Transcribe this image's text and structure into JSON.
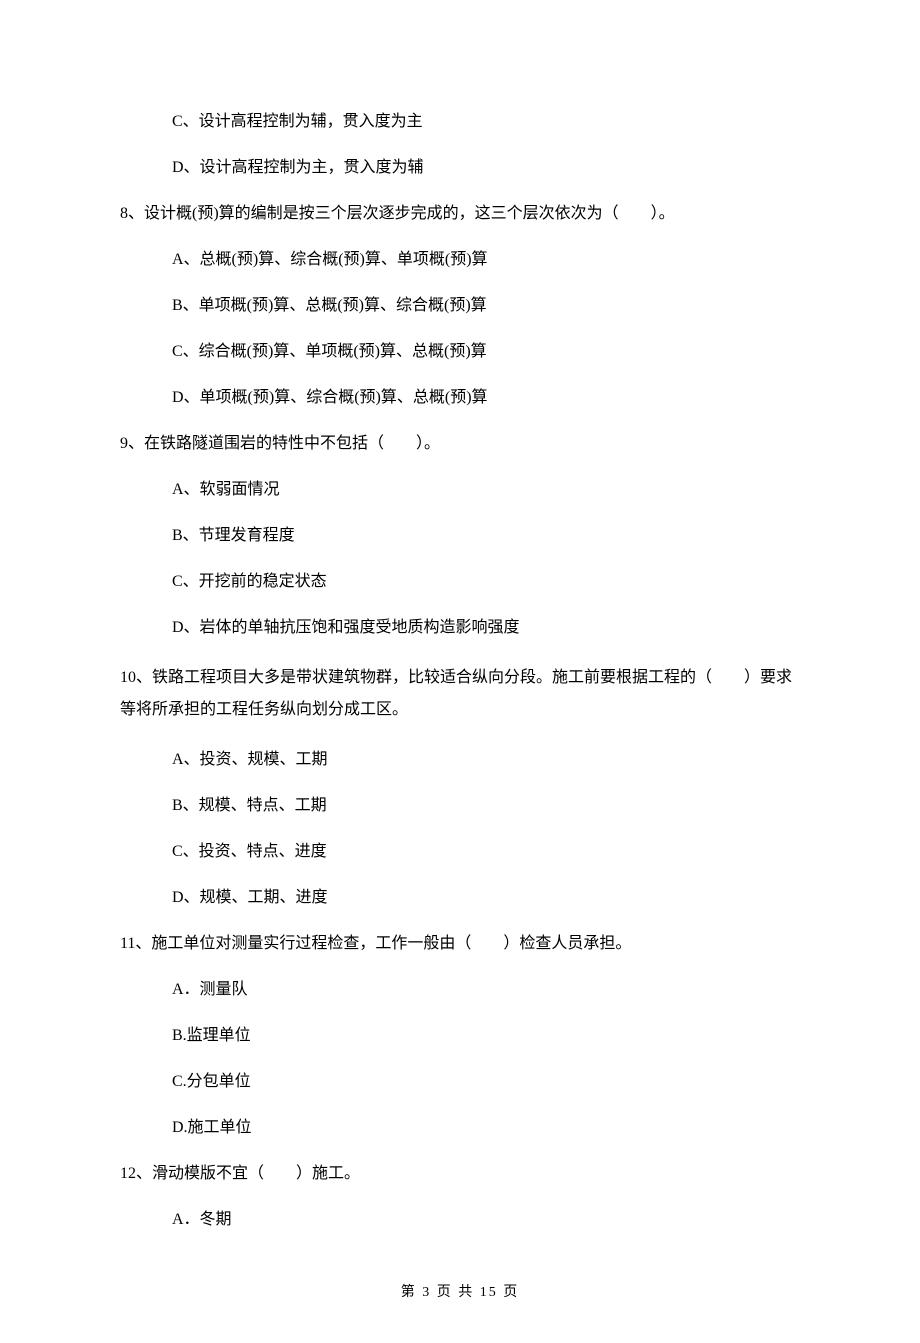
{
  "q7": {
    "options": {
      "C": "C、设计高程控制为辅，贯入度为主",
      "D": "D、设计高程控制为主，贯入度为辅"
    }
  },
  "q8": {
    "stem": "8、设计概(预)算的编制是按三个层次逐步完成的，这三个层次依次为（　　）。",
    "options": {
      "A": "A、总概(预)算、综合概(预)算、单项概(预)算",
      "B": "B、单项概(预)算、总概(预)算、综合概(预)算",
      "C": "C、综合概(预)算、单项概(预)算、总概(预)算",
      "D": "D、单项概(预)算、综合概(预)算、总概(预)算"
    }
  },
  "q9": {
    "stem": "9、在铁路隧道围岩的特性中不包括（　　）。",
    "options": {
      "A": "A、软弱面情况",
      "B": "B、节理发育程度",
      "C": "C、开挖前的稳定状态",
      "D": "D、岩体的单轴抗压饱和强度受地质构造影响强度"
    }
  },
  "q10": {
    "stem": "10、铁路工程项目大多是带状建筑物群，比较适合纵向分段。施工前要根据工程的（　　）要求等将所承担的工程任务纵向划分成工区。",
    "options": {
      "A": "A、投资、规模、工期",
      "B": "B、规模、特点、工期",
      "C": "C、投资、特点、进度",
      "D": "D、规模、工期、进度"
    }
  },
  "q11": {
    "stem": "11、施工单位对测量实行过程检查，工作一般由（　　）检查人员承担。",
    "options": {
      "A": "A．测量队",
      "B": "B.监理单位",
      "C": "C.分包单位",
      "D": "D.施工单位"
    }
  },
  "q12": {
    "stem": "12、滑动模版不宜（　　）施工。",
    "options": {
      "A": "A．冬期"
    }
  },
  "footer": "第 3 页 共 15 页"
}
